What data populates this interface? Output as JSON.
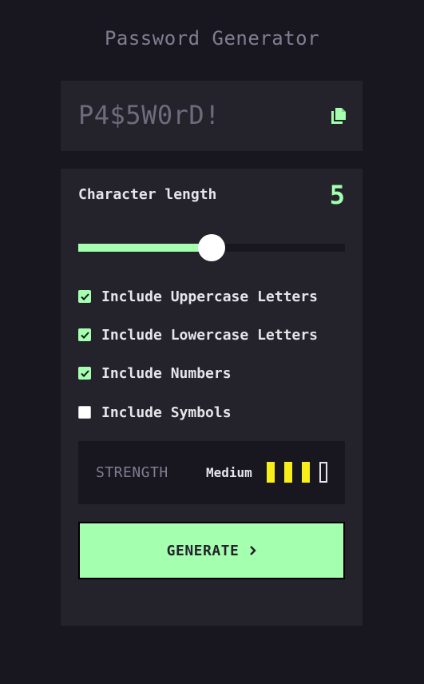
{
  "app": {
    "title": "Password Generator"
  },
  "output": {
    "password": "P4$5W0rD!",
    "copy_icon": "copy-icon"
  },
  "length": {
    "label": "Character length",
    "value": "5",
    "slider_fraction": 0.5
  },
  "options": [
    {
      "label": "Include Uppercase Letters",
      "checked": true
    },
    {
      "label": "Include Lowercase Letters",
      "checked": true
    },
    {
      "label": "Include Numbers",
      "checked": true
    },
    {
      "label": "Include Symbols",
      "checked": false
    }
  ],
  "strength": {
    "label": "STRENGTH",
    "level": "Medium",
    "bars_filled": 3,
    "bars_total": 4,
    "bar_color": "#f8ef1a"
  },
  "generate": {
    "label": "GENERATE",
    "icon": "chevron-right-icon"
  },
  "colors": {
    "accent": "#a4ffaf",
    "background": "#18171f",
    "panel": "#24232c"
  }
}
